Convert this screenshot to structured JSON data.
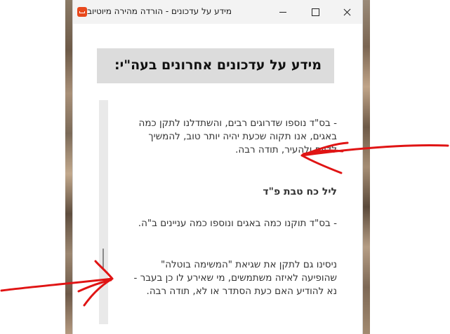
{
  "window": {
    "title": "מידע על עדכונים - הורדה מהירה מיוטיוב"
  },
  "content": {
    "heading": "מידע על עדכונים אחרונים בעה\"י:",
    "paragraph_1": "- בס\"ד נוספו שדרוגים רבים, והשתדלנו לתקן כמה באגים, אנו תקוה שכעת יהיה יותר טוב, להמשיך לדווח ולהעיר, תודה רבה.",
    "section_date": "ליל כח טבת פ\"ד",
    "paragraph_2": "- בס\"ד תוקנו כמה באגים ונוספו כמה עניינים ב\"ה.",
    "paragraph_3": "ניסינו גם לתקן את שגיאת \"המשימה בוטלה\" שהופיעה לאיזה משתמשים, מי שאירע לו כן בעבר - נא להודיע האם כעת הסתדר או לא, תודה רבה."
  },
  "colors": {
    "app_icon": "#e8481c",
    "annotation": "#e01414"
  }
}
